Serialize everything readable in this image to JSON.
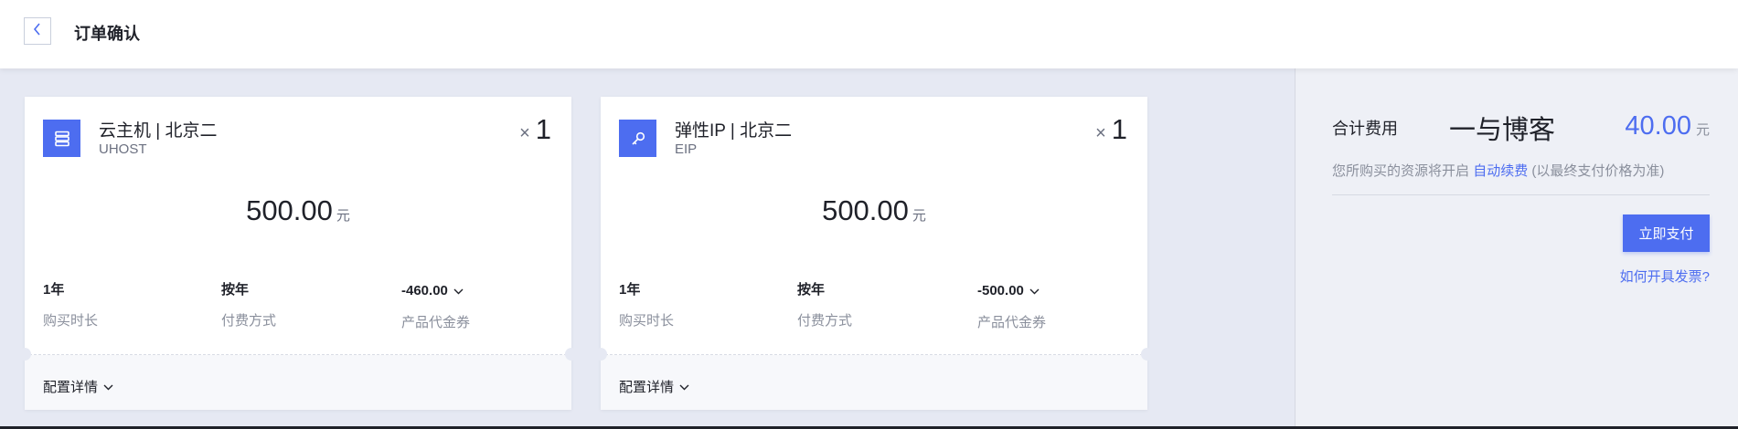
{
  "header": {
    "title": "订单确认",
    "back_icon": "chevron-left-icon"
  },
  "products": [
    {
      "icon": "server-icon",
      "name": "云主机 | 北京二",
      "code": "UHOST",
      "qty_prefix": "×",
      "qty": "1",
      "price": "500.00",
      "price_unit": "元",
      "duration_value": "1年",
      "duration_label": "购买时长",
      "payment_value": "按年",
      "payment_label": "付费方式",
      "voucher_value": "-460.00",
      "voucher_label": "产品代金券",
      "config_toggle": "配置详情"
    },
    {
      "icon": "key-icon",
      "name": "弹性IP | 北京二",
      "code": "EIP",
      "qty_prefix": "×",
      "qty": "1",
      "price": "500.00",
      "price_unit": "元",
      "duration_value": "1年",
      "duration_label": "购买时长",
      "payment_value": "按年",
      "payment_label": "付费方式",
      "voucher_value": "-500.00",
      "voucher_label": "产品代金券",
      "config_toggle": "配置详情"
    }
  ],
  "summary": {
    "total_label": "合计费用",
    "watermark": "一与博客",
    "total_amount": "40.00",
    "total_unit": "元",
    "renew_prefix": "您所购买的资源将开启",
    "renew_link": "自动续费",
    "renew_suffix": "(以最终支付价格为准)",
    "pay_button": "立即支付",
    "invoice_link": "如何开具发票?"
  },
  "colors": {
    "accent": "#4d6df0",
    "page_bg": "#e6e9f3",
    "sidebar_bg": "#eef0f6"
  }
}
